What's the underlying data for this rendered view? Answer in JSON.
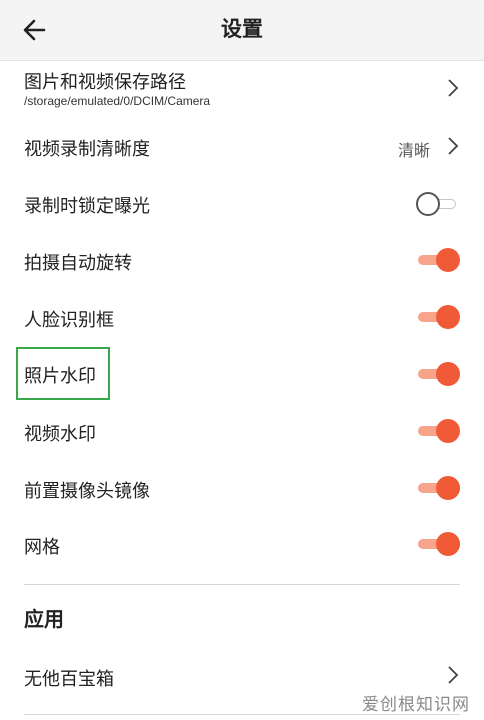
{
  "header": {
    "title": "设置"
  },
  "settings": [
    {
      "label": "图片和视频保存路径",
      "sub": "/storage/emulated/0/DCIM/Camera",
      "type": "nav"
    },
    {
      "label": "视频录制清晰度",
      "value": "清晰",
      "type": "nav"
    },
    {
      "label": "录制时锁定曝光",
      "type": "toggle",
      "on": false
    },
    {
      "label": "拍摄自动旋转",
      "type": "toggle",
      "on": true
    },
    {
      "label": "人脸识别框",
      "type": "toggle",
      "on": true
    },
    {
      "label": "照片水印",
      "type": "toggle",
      "on": true,
      "highlighted": true
    },
    {
      "label": "视频水印",
      "type": "toggle",
      "on": true
    },
    {
      "label": "前置摄像头镜像",
      "type": "toggle",
      "on": true
    },
    {
      "label": "网格",
      "type": "toggle",
      "on": true
    }
  ],
  "apps_section": {
    "title": "应用",
    "items": [
      {
        "label": "无他百宝箱",
        "type": "nav"
      }
    ]
  },
  "watermark": "爱创根知识网",
  "colors": {
    "accent": "#f15a36",
    "accent_track": "#f7a48a",
    "highlight": "#39a84a"
  }
}
